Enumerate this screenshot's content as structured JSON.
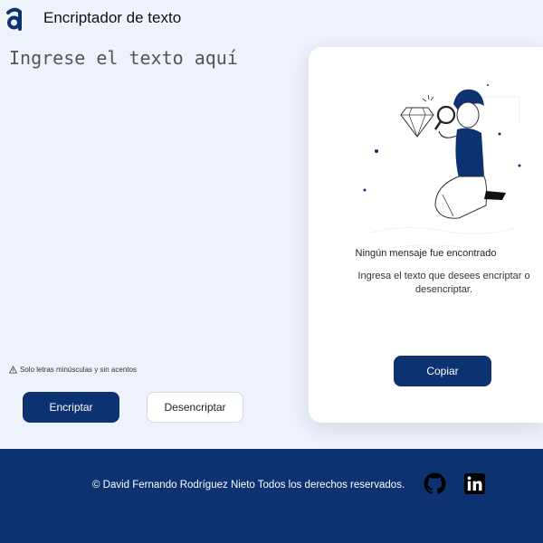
{
  "header": {
    "title": "Encriptador de texto",
    "logo_icon": "alura-logo-icon"
  },
  "input": {
    "placeholder": "Ingrese el texto aquí",
    "value": ""
  },
  "hint": {
    "icon": "warning-icon",
    "text": "Solo letras minúsculas y sin acentos"
  },
  "actions": {
    "encrypt_label": "Encriptar",
    "decrypt_label": "Desencriptar"
  },
  "output": {
    "illustration": "person-with-magnifier-illustration",
    "title": "Ningún mensaje fue encontrado",
    "body": "Ingresa el texto que desees encriptar o desencriptar.",
    "copy_label": "Copiar"
  },
  "footer": {
    "text": "© David Fernando Rodríguez Nieto Todos los derechos reservados.",
    "links": [
      {
        "icon": "github-icon"
      },
      {
        "icon": "linkedin-icon"
      }
    ]
  },
  "colors": {
    "background": "#eef2fb",
    "primary": "#0c3272",
    "card": "#ffffff"
  }
}
